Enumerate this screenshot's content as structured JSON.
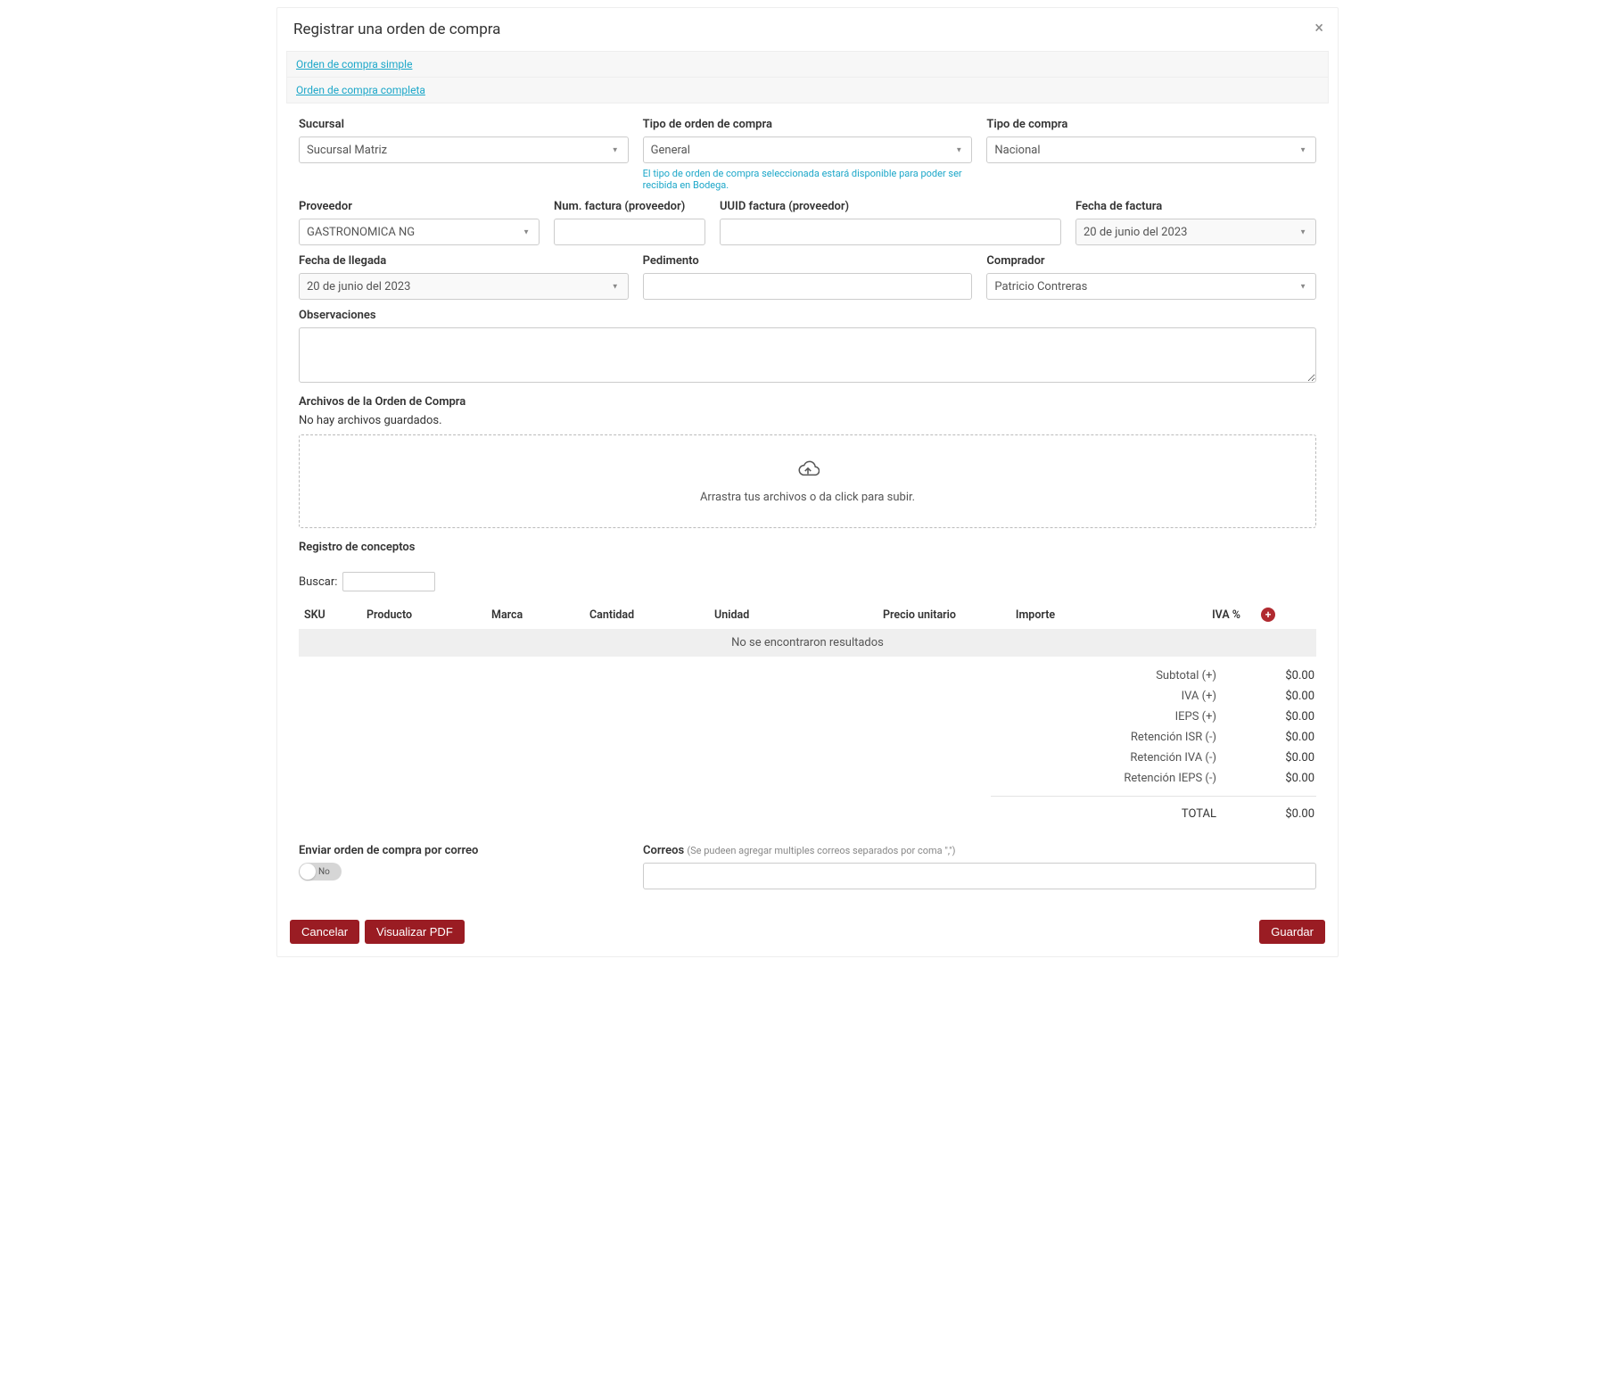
{
  "modal": {
    "title": "Registrar una orden de compra",
    "close": "×"
  },
  "tabs": {
    "simple": "Orden de compra simple",
    "completa": "Orden de compra completa"
  },
  "fields": {
    "sucursal": {
      "label": "Sucursal",
      "value": "Sucursal Matriz"
    },
    "tipo_orden": {
      "label": "Tipo de orden de compra",
      "value": "General",
      "helper": "El tipo de orden de compra seleccionada estará disponible para poder ser recibida en Bodega."
    },
    "tipo_compra": {
      "label": "Tipo de compra",
      "value": "Nacional"
    },
    "proveedor": {
      "label": "Proveedor",
      "value": "GASTRONOMICA NG"
    },
    "num_factura": {
      "label": "Num. factura (proveedor)",
      "value": ""
    },
    "uuid_factura": {
      "label": "UUID factura (proveedor)",
      "value": ""
    },
    "fecha_factura": {
      "label": "Fecha de factura",
      "value": "20 de junio del  2023"
    },
    "fecha_llegada": {
      "label": "Fecha de llegada",
      "value": "20 de junio del  2023"
    },
    "pedimento": {
      "label": "Pedimento",
      "value": ""
    },
    "comprador": {
      "label": "Comprador",
      "value": "Patricio Contreras"
    },
    "observaciones": {
      "label": "Observaciones",
      "value": ""
    }
  },
  "files": {
    "title": "Archivos de la Orden de Compra",
    "none": "No hay archivos guardados.",
    "drop_hint": "Arrastra tus archivos o da click para subir."
  },
  "conceptos": {
    "title": "Registro de conceptos",
    "search_label": "Buscar:",
    "search_value": "",
    "headers": {
      "sku": "SKU",
      "producto": "Producto",
      "marca": "Marca",
      "cantidad": "Cantidad",
      "unidad": "Unidad",
      "precio": "Precio unitario",
      "importe": "Importe",
      "iva": "IVA %"
    },
    "no_results": "No se encontraron resultados"
  },
  "totals": {
    "rows": [
      {
        "label": "Subtotal (+)",
        "value": "$0.00"
      },
      {
        "label": "IVA (+)",
        "value": "$0.00"
      },
      {
        "label": "IEPS (+)",
        "value": "$0.00"
      },
      {
        "label": "Retención ISR (-)",
        "value": "$0.00"
      },
      {
        "label": "Retención IVA (-)",
        "value": "$0.00"
      },
      {
        "label": "Retención IEPS (-)",
        "value": "$0.00"
      }
    ],
    "final": {
      "label": "TOTAL",
      "value": "$0.00"
    }
  },
  "mail": {
    "send_label": "Enviar orden de compra por correo",
    "toggle_value": "No",
    "correos_label": "Correos",
    "correos_note": "(Se pudeen agregar multiples correos separados por coma \",\")",
    "correos_value": ""
  },
  "footer": {
    "cancelar": "Cancelar",
    "pdf": "Visualizar PDF",
    "guardar": "Guardar"
  }
}
